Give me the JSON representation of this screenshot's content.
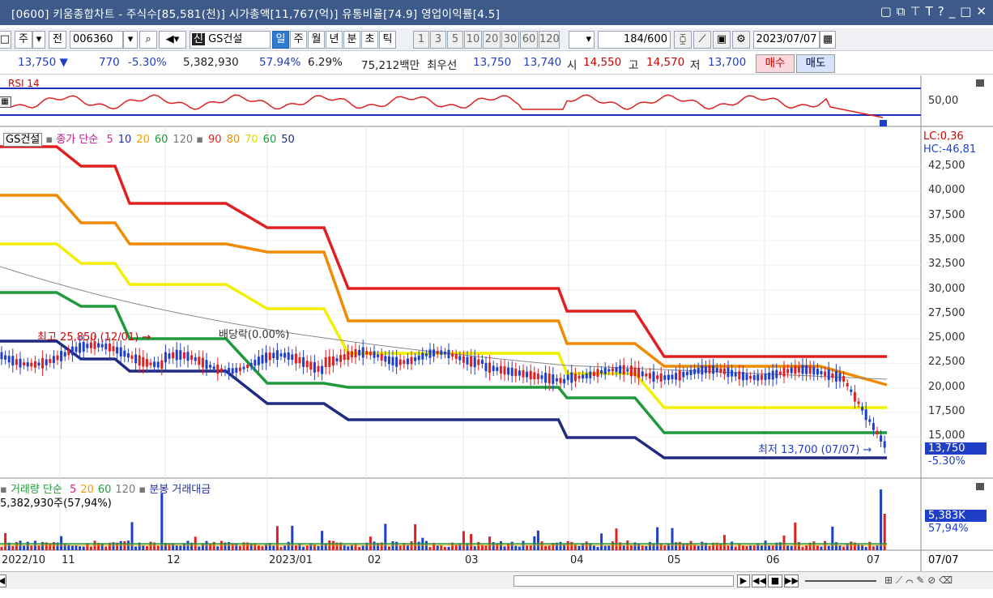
{
  "title": "[0600] 키움종합차트 - 주식수[85,581(천)] 시가총액[11,767(억)] 유통비율[74.9] 영업이익률[4.5]",
  "toolbar": {
    "period_week": "주",
    "prev": "전",
    "code": "006360",
    "new_badge": "신",
    "stock_name": "GS건설",
    "tabs": [
      "일",
      "주",
      "월",
      "년",
      "분",
      "초",
      "틱"
    ],
    "selected_tab": "일",
    "numbers": [
      "1",
      "3",
      "5",
      "10",
      "20",
      "30",
      "60",
      "120"
    ],
    "count": "184",
    "count_total": "/600",
    "date": "2023/07/07"
  },
  "quote": {
    "price": "13,750",
    "change": "770",
    "change_pct": "-5.30%",
    "volume": "5,382,930",
    "vol_ratio": "57.94%",
    "turnover": "6.29%",
    "amount": "75,212백만",
    "best_label": "최우선",
    "best_ask": "13,750",
    "best_bid": "13,740",
    "open_label": "시",
    "open": "14,550",
    "high_label": "고",
    "high": "14,570",
    "low_label": "저",
    "low": "13,700",
    "buy": "매수",
    "sell": "매도"
  },
  "rsi_panel": {
    "label": "RSI 14",
    "axis": [
      "50,00"
    ]
  },
  "price_panel": {
    "legend": {
      "name": "GS건설",
      "close_label": "종가 단순",
      "ma": [
        {
          "v": "5",
          "c": "#e91e8c"
        },
        {
          "v": "10",
          "c": "#1f2fa8"
        },
        {
          "v": "20",
          "c": "#f0a000"
        },
        {
          "v": "60",
          "c": "#1f9a3a"
        },
        {
          "v": "120",
          "c": "#777777"
        },
        {
          "v": "90",
          "c": "#e02020"
        },
        {
          "v": "80",
          "c": "#f08a00"
        },
        {
          "v": "70",
          "c": "#f0f000"
        },
        {
          "v": "60",
          "c": "#1f9a3a"
        },
        {
          "v": "50",
          "c": "#1f2a80"
        }
      ]
    },
    "lc": "LC:0,36",
    "hc": "HC:-46,81",
    "y_ticks": [
      "42,500",
      "40,000",
      "37,500",
      "35,000",
      "32,500",
      "30,000",
      "27,500",
      "25,000",
      "22,500",
      "20,000",
      "17,500",
      "15,000"
    ],
    "high_annot": "최고 25,850 (12/01)",
    "low_annot": "최저 13,700 (07/07)",
    "dividend": "배당락(0.00%)",
    "price_tag": "13,750",
    "pct_tag": "-5.30%"
  },
  "volume_panel": {
    "legend": "거래량 단순",
    "ma": [
      {
        "v": "5",
        "c": "#e91e8c"
      },
      {
        "v": "20",
        "c": "#f0a000"
      },
      {
        "v": "60",
        "c": "#1f9a3a"
      },
      {
        "v": "120",
        "c": "#777777"
      }
    ],
    "legend2": "분봉 거래대금",
    "value": "5,382,930주(57,94%)",
    "tag": "5,383K",
    "tag_pct": "57,94%"
  },
  "x_axis": [
    "2022/10",
    "11",
    "12",
    "2023/01",
    "02",
    "03",
    "04",
    "05",
    "06",
    "07"
  ],
  "x_last": "07/07",
  "chart_data": {
    "type": "line",
    "title": "GS건설",
    "y_range": [
      13700,
      25850
    ],
    "series": [
      {
        "name": "90",
        "color": "#e02020"
      },
      {
        "name": "80",
        "color": "#f08a00"
      },
      {
        "name": "70",
        "color": "#f0f000"
      },
      {
        "name": "60",
        "color": "#1f9a3a"
      },
      {
        "name": "50",
        "color": "#1f2a80"
      }
    ],
    "last_close": 13750,
    "high": 25850,
    "low": 13700
  }
}
